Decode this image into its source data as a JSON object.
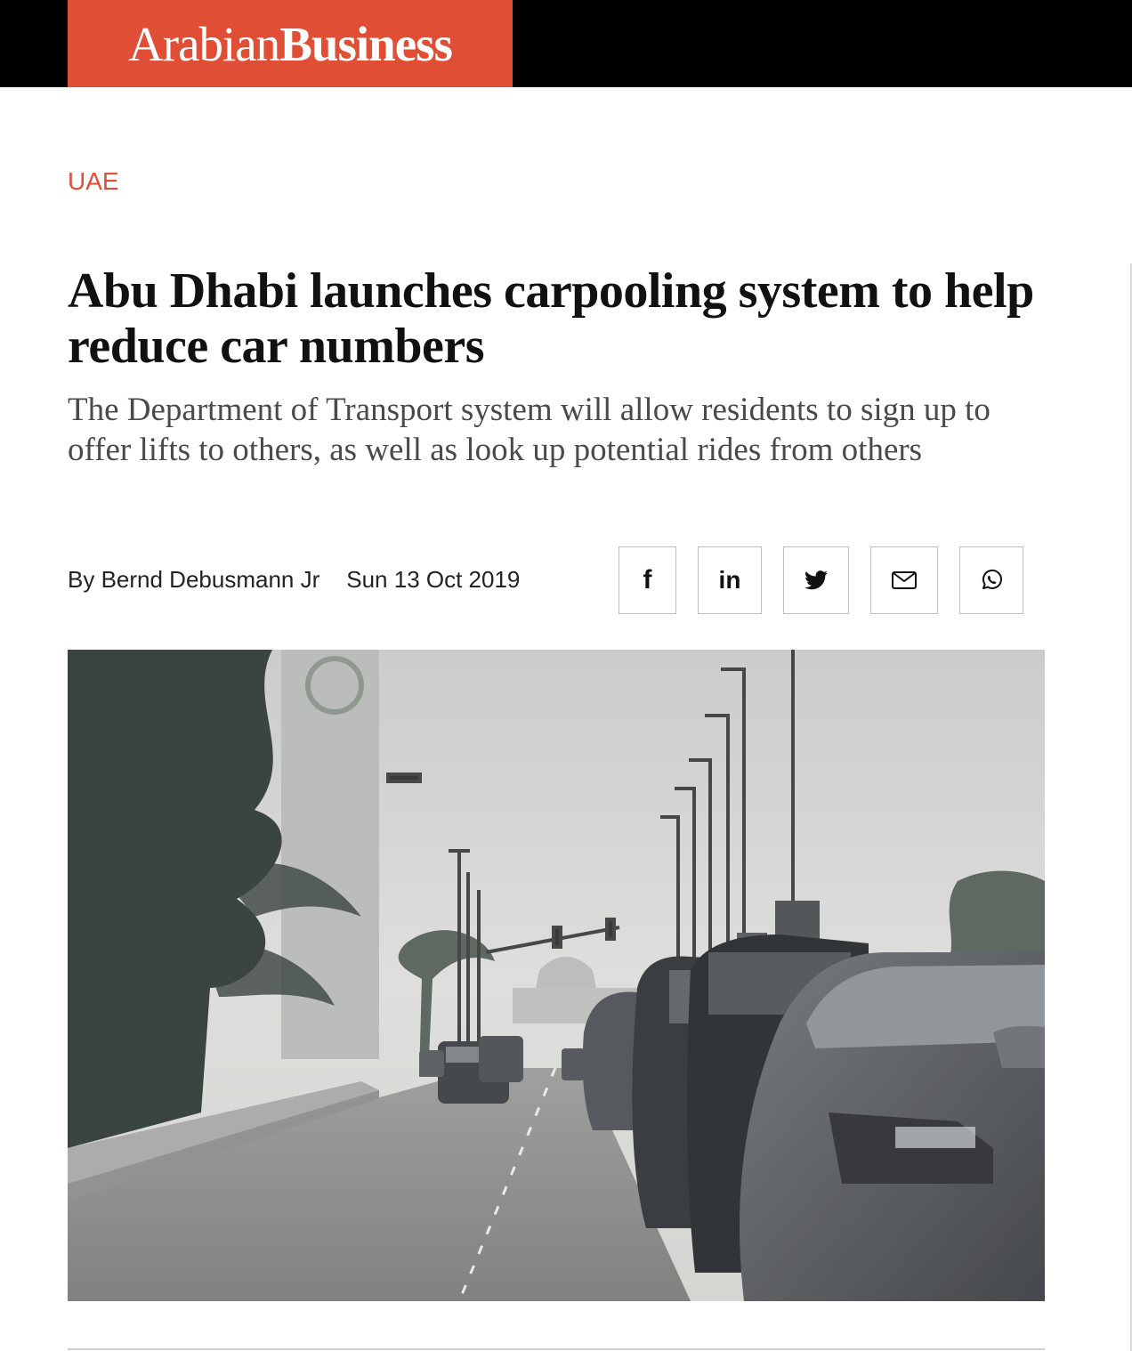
{
  "brand": {
    "name_light": "Arabian",
    "name_bold": "Business",
    "logo_color": "#e04e35"
  },
  "article": {
    "category": "UAE",
    "headline": "Abu Dhabi launches carpooling system to help reduce car numbers",
    "subheadline": "The Department of Transport system will allow residents to sign up to offer lifts to others, as well as look up potential rides from others",
    "author": "By Bernd Debusmann Jr",
    "date": "Sun 13 Oct 2019"
  },
  "share": [
    {
      "network": "facebook",
      "icon": "facebook-icon",
      "glyph": "f"
    },
    {
      "network": "linkedin",
      "icon": "linkedin-icon",
      "glyph": "in"
    },
    {
      "network": "twitter",
      "icon": "twitter-icon"
    },
    {
      "network": "email",
      "icon": "envelope-icon"
    },
    {
      "network": "whatsapp",
      "icon": "whatsapp-icon"
    }
  ],
  "colors": {
    "accent": "#e04e35",
    "header_bg": "#000000",
    "text": "#111111",
    "subtext": "#4a4a4a"
  }
}
